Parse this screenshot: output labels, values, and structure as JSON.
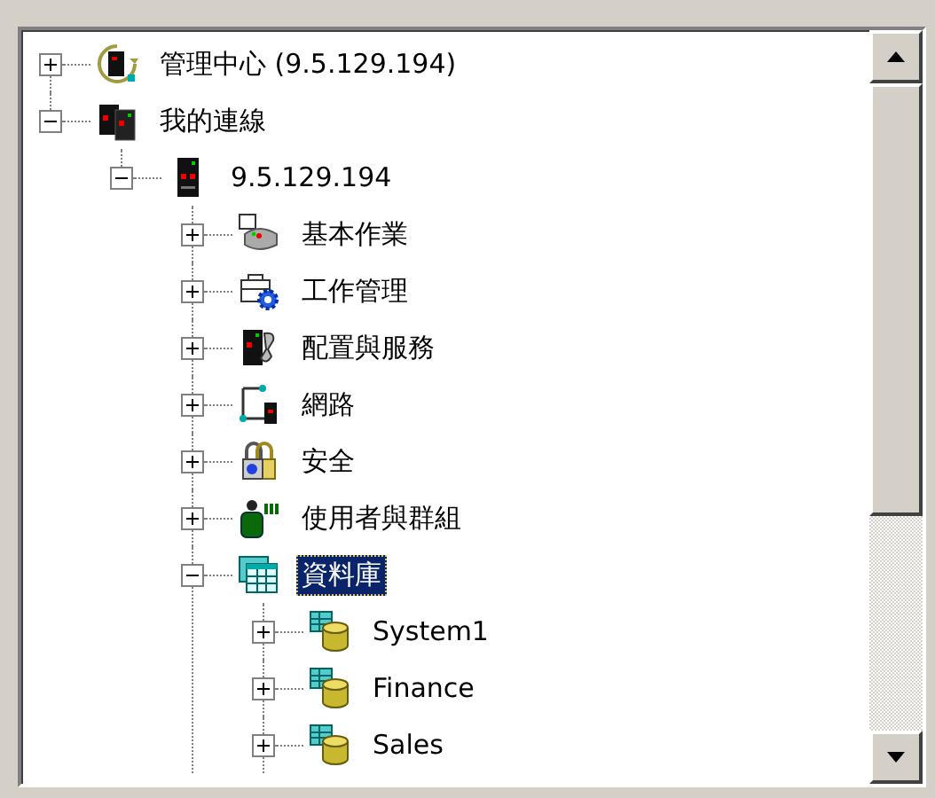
{
  "tree": [
    {
      "label": "管理中心 (9.5.129.194)",
      "kind": "central",
      "expanded": false,
      "selected": false
    },
    {
      "label": "我的連線",
      "kind": "connections",
      "expanded": true,
      "selected": false,
      "children": [
        {
          "label": "9.5.129.194",
          "kind": "server",
          "expanded": true,
          "selected": false,
          "children": [
            {
              "label": "基本作業",
              "kind": "basic",
              "expanded": false,
              "selected": false
            },
            {
              "label": "工作管理",
              "kind": "work",
              "expanded": false,
              "selected": false
            },
            {
              "label": "配置與服務",
              "kind": "config",
              "expanded": false,
              "selected": false
            },
            {
              "label": "網路",
              "kind": "network",
              "expanded": false,
              "selected": false
            },
            {
              "label": "安全",
              "kind": "security",
              "expanded": false,
              "selected": false
            },
            {
              "label": "使用者與群組",
              "kind": "users",
              "expanded": false,
              "selected": false
            },
            {
              "label": "資料庫",
              "kind": "database",
              "expanded": true,
              "selected": true,
              "children": [
                {
                  "label": "System1",
                  "kind": "library",
                  "expanded": false,
                  "selected": false
                },
                {
                  "label": "Finance",
                  "kind": "library",
                  "expanded": false,
                  "selected": false
                },
                {
                  "label": "Sales",
                  "kind": "library",
                  "expanded": false,
                  "selected": false
                }
              ]
            }
          ]
        }
      ]
    }
  ]
}
